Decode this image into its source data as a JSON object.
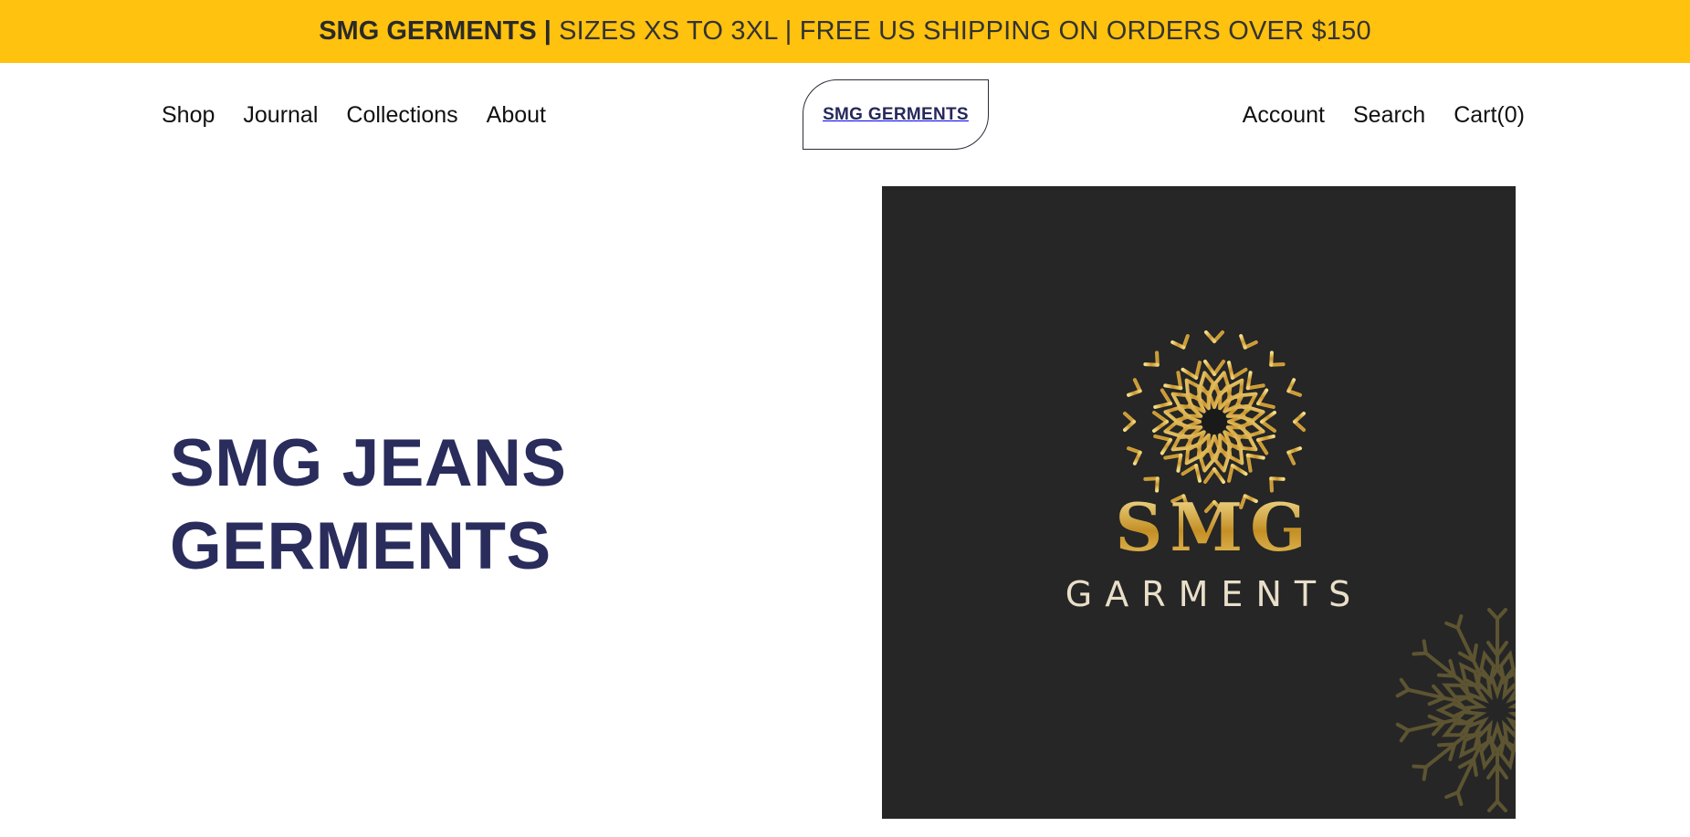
{
  "announcement": {
    "brand": "SMG GERMENTS |",
    "message": " SIZES XS TO 3XL | FREE US SHIPPING ON ORDERS OVER $150"
  },
  "nav": {
    "left": [
      "Shop",
      "Journal",
      "Collections",
      "About"
    ],
    "right": [
      "Account",
      "Search",
      "Cart(0)"
    ]
  },
  "logo": {
    "text": "SMG GERMENTS"
  },
  "hero": {
    "title_line1": "SMG JEANS",
    "title_line2": "GERMENTS",
    "image": {
      "brand_top": "SMG",
      "brand_bottom": "GARMENTS",
      "background": "#262626",
      "emblem_color": "#d9b24a"
    }
  },
  "colors": {
    "announcement_bg": "#ffc20e",
    "title_color": "#2a2c5c",
    "logo_text": "#26285c"
  }
}
